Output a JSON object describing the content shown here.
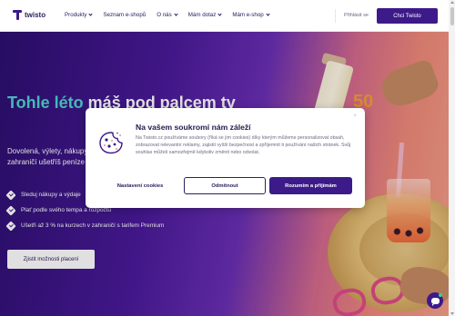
{
  "brand": {
    "name": "twisto"
  },
  "nav": {
    "items": [
      {
        "label": "Produkty",
        "dropdown": true
      },
      {
        "label": "Seznam e-shopů",
        "dropdown": false
      },
      {
        "label": "O nás",
        "dropdown": true
      },
      {
        "label": "Mám dotaz",
        "dropdown": true
      },
      {
        "label": "Mám e-shop",
        "dropdown": true
      }
    ],
    "login_label": "Přihlásit se",
    "cta_label": "Chci Twisto"
  },
  "hero": {
    "title_accent": "Tohle léto",
    "title_rest": " máš pod palcem ty",
    "subtitle": "Dovolená, výlety, nákupy... Sám si určíš, co kdy platíš, a v zahraničí ušetříš peníze v bance.",
    "bullets": [
      "Sleduj nákupy a výdaje",
      "Plať podle svého tempa a rozpočtu",
      "Ušetři až 3 % na kurzech v zahraničí s tarifem Premium"
    ],
    "button_label": "Zjistit možnosti placení",
    "sunscreen_label": "50"
  },
  "cookie_modal": {
    "title": "Na vašem soukromí nám záleží",
    "text": "Na Twisto.cz používáme soubory (říká se jim cookies) díky kterým můžeme personalizovat obsah, zobrazovat relevantní reklamy, zajistit vyšší bezpečnost a zpříjemnit ti používání našich stránek. Svůj souhlas můžeš samozřejmě kdykoliv změnit nebo odvolat.",
    "close_label": "×",
    "settings_label": "Nastavení cookies",
    "reject_label": "Odmítnout",
    "accept_label": "Rozumím a přijímám"
  },
  "colors": {
    "brand_primary": "#3c1a89",
    "accent_teal": "#4fd3d0"
  }
}
